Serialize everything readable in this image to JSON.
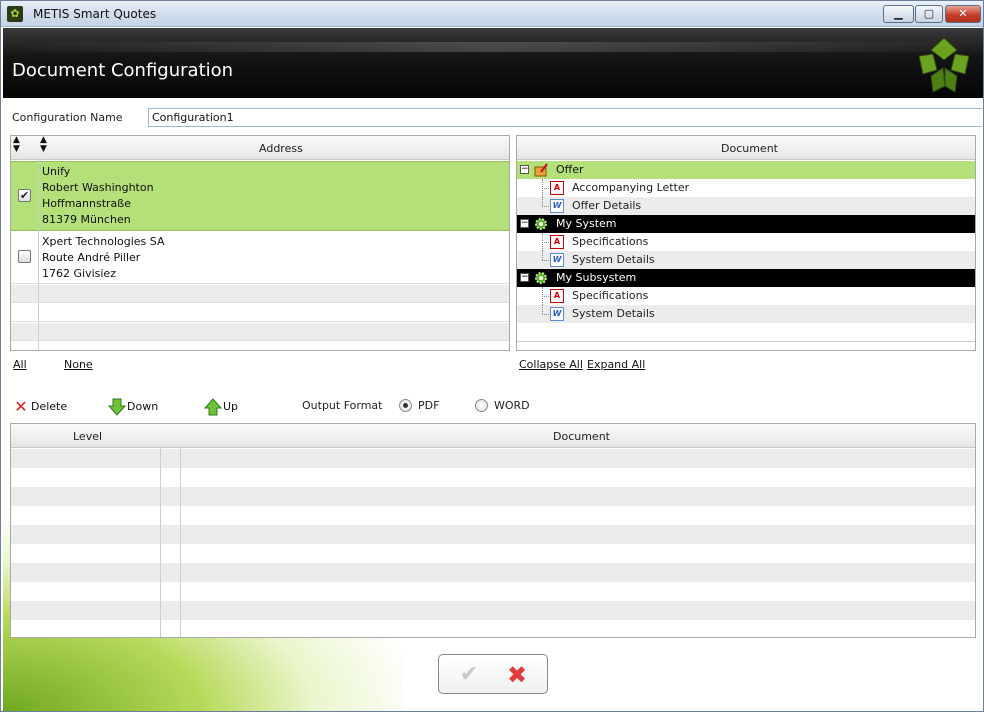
{
  "window": {
    "title": "METIS Smart Quotes",
    "min_glyph": "▁",
    "max_glyph": "▢",
    "close_glyph": "✕"
  },
  "header": {
    "title": "Document Configuration"
  },
  "config": {
    "label": "Configuration Name",
    "value": "Configuration1"
  },
  "address_panel": {
    "column_title": "Address",
    "rows": [
      {
        "checked": true,
        "lines": [
          "Unify",
          "Robert Washinghton",
          "Hoffmannstraße",
          "81379 München"
        ]
      },
      {
        "checked": false,
        "lines": [
          "Xpert Technologies SA",
          "Route André Piller",
          "1762 Givisiez"
        ]
      }
    ],
    "select_all": "All",
    "select_none": "None"
  },
  "document_panel": {
    "column_title": "Document",
    "groups": [
      {
        "label": "Offer",
        "icon": "offer-icon",
        "children": [
          {
            "label": "Accompanying Letter",
            "icon": "pdf-icon"
          },
          {
            "label": "Offer Details",
            "icon": "word-icon"
          }
        ]
      },
      {
        "label": "My System",
        "icon": "gear-icon",
        "children": [
          {
            "label": "Specifications",
            "icon": "pdf-icon"
          },
          {
            "label": "System Details",
            "icon": "word-icon"
          }
        ]
      },
      {
        "label": "My Subsystem",
        "icon": "gear-icon",
        "children": [
          {
            "label": "Specifications",
            "icon": "pdf-icon"
          },
          {
            "label": "System Details",
            "icon": "word-icon"
          }
        ]
      }
    ],
    "collapse_all": "Collapse All",
    "expand_all": "Expand All"
  },
  "toolbar": {
    "delete": "Delete",
    "down": "Down",
    "up": "Up",
    "output_format_label": "Output Format",
    "formats": [
      {
        "label": "PDF",
        "selected": true
      },
      {
        "label": "WORD",
        "selected": false
      }
    ]
  },
  "level_grid": {
    "col_level": "Level",
    "col_document": "Document",
    "rows": []
  },
  "actions": {
    "ok_glyph": "✔",
    "cancel_glyph": "✖"
  },
  "colors": {
    "selected_green": "#b4e07a",
    "header_black": "#000000",
    "brand_green": "#7fb52a"
  }
}
